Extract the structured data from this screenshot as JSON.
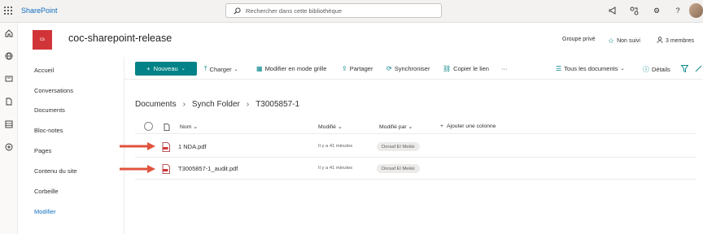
{
  "suite": {
    "app_name": "SharePoint",
    "search_placeholder": "Rechercher dans cette bibliothèque"
  },
  "site": {
    "logo_initials": "cs",
    "title": "coc-sharepoint-release",
    "group": "Groupe privé",
    "follow": "Non suivi",
    "members": "3 membres"
  },
  "nav": {
    "items": [
      {
        "label": "Accueil"
      },
      {
        "label": "Conversations"
      },
      {
        "label": "Documents"
      },
      {
        "label": "Bloc-notes"
      },
      {
        "label": "Pages"
      },
      {
        "label": "Contenu du site"
      },
      {
        "label": "Corbeille"
      },
      {
        "label": "Modifier"
      }
    ]
  },
  "commands": {
    "new": "Nouveau",
    "upload": "Charger",
    "grid": "Modifier en mode grille",
    "share": "Partager",
    "sync": "Synchroniser",
    "copy_link": "Copier le lien",
    "more": "···",
    "view": "Tous les documents",
    "details": "Détails"
  },
  "breadcrumb": [
    "Documents",
    "Synch Folder",
    "T3005857-1"
  ],
  "table": {
    "columns": {
      "name": "Nom",
      "modified": "Modifié",
      "modified_by": "Modifié par",
      "add_column": "Ajouter une colonne"
    },
    "rows": [
      {
        "name": "1 NDA.pdf",
        "modified": "Il y a 41 minutes",
        "modified_by": "Dorsaf El Mekki"
      },
      {
        "name": "T3005857-1_audit.pdf",
        "modified": "Il y a 41 minutes",
        "modified_by": "Dorsaf El Mekki"
      }
    ]
  },
  "colors": {
    "accent": "#038387",
    "brand_blue": "#106ebe",
    "logo_red": "#d13438",
    "arrow_red": "#e0533d"
  }
}
